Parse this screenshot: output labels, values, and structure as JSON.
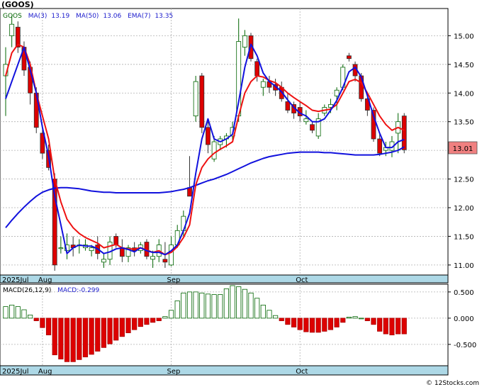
{
  "chart_data": [
    {
      "type": "candlestick",
      "title": "(GOOS)",
      "legend": [
        {
          "text": "GOOS",
          "color": "#006400"
        },
        {
          "text": "MA(3)",
          "color": "#1a1acc"
        },
        {
          "text": "13.19",
          "color": "#1a1acc"
        },
        {
          "text": "MA(50)",
          "color": "#1a1acc"
        },
        {
          "text": "13.06",
          "color": "#1a1acc"
        },
        {
          "text": "EMA(7)",
          "color": "#1a1acc"
        },
        {
          "text": "13.35",
          "color": "#1a1acc"
        }
      ],
      "yaxis": {
        "side": "right",
        "range": [
          10.85,
          15.45
        ],
        "ticks": [
          "11.00",
          "11.50",
          "12.00",
          "12.50",
          "13.00",
          "13.50",
          "14.00",
          "14.50",
          "15.00"
        ]
      },
      "last_price_label": "13.01",
      "x_labels": [
        {
          "index": 0,
          "text": "2025Jul"
        },
        {
          "index": 6,
          "text": "Aug"
        },
        {
          "index": 27,
          "text": "Sep"
        },
        {
          "index": 48,
          "text": "Oct"
        }
      ],
      "colors": {
        "up": "#006400",
        "down": "#dd0000",
        "ema": "#ee1111",
        "ma": "#1111dd",
        "axis_band": "#add8e6"
      },
      "ohlc": [
        [
          14.3,
          14.8,
          13.6,
          14.5
        ],
        [
          15.0,
          15.35,
          14.8,
          15.2
        ],
        [
          15.15,
          15.25,
          14.7,
          14.8
        ],
        [
          14.8,
          14.9,
          14.3,
          14.4
        ],
        [
          14.45,
          14.55,
          13.8,
          14.0
        ],
        [
          14.0,
          14.1,
          13.3,
          13.4
        ],
        [
          13.3,
          13.4,
          12.85,
          12.95
        ],
        [
          13.0,
          13.1,
          12.65,
          12.7
        ],
        [
          12.5,
          12.6,
          10.9,
          11.0
        ],
        [
          11.3,
          11.5,
          11.2,
          11.3
        ],
        [
          11.25,
          11.55,
          11.1,
          11.35
        ],
        [
          11.35,
          11.5,
          11.15,
          11.3
        ],
        [
          11.35,
          11.45,
          11.2,
          11.35
        ],
        [
          11.3,
          11.45,
          11.25,
          11.35
        ],
        [
          11.25,
          11.35,
          11.15,
          11.3
        ],
        [
          11.35,
          11.5,
          11.1,
          11.2
        ],
        [
          11.05,
          11.2,
          10.95,
          11.1
        ],
        [
          11.1,
          11.5,
          11.0,
          11.4
        ],
        [
          11.5,
          11.55,
          11.3,
          11.35
        ],
        [
          11.3,
          11.45,
          11.05,
          11.15
        ],
        [
          11.15,
          11.35,
          11.05,
          11.3
        ],
        [
          11.3,
          11.4,
          11.15,
          11.25
        ],
        [
          11.25,
          11.4,
          11.2,
          11.35
        ],
        [
          11.4,
          11.45,
          11.1,
          11.15
        ],
        [
          11.1,
          11.25,
          10.95,
          11.15
        ],
        [
          11.15,
          11.45,
          11.05,
          11.35
        ],
        [
          11.1,
          11.4,
          10.95,
          11.05
        ],
        [
          11.0,
          11.5,
          10.98,
          11.35
        ],
        [
          11.35,
          11.7,
          11.3,
          11.6
        ],
        [
          11.6,
          11.95,
          11.5,
          11.85
        ],
        [
          12.35,
          12.9,
          12.2,
          12.2
        ],
        [
          13.6,
          14.3,
          13.5,
          14.2
        ],
        [
          14.3,
          14.35,
          13.3,
          13.4
        ],
        [
          13.4,
          13.5,
          12.95,
          13.1
        ],
        [
          12.85,
          13.25,
          12.8,
          13.15
        ],
        [
          13.1,
          13.25,
          13.0,
          13.2
        ],
        [
          13.2,
          13.3,
          13.05,
          13.25
        ],
        [
          13.25,
          13.5,
          13.15,
          13.4
        ],
        [
          13.6,
          15.3,
          13.5,
          14.9
        ],
        [
          14.8,
          15.1,
          14.65,
          15.0
        ],
        [
          15.0,
          15.05,
          14.55,
          14.6
        ],
        [
          14.55,
          14.6,
          14.2,
          14.3
        ],
        [
          14.1,
          14.25,
          13.95,
          14.2
        ],
        [
          14.2,
          14.3,
          14.0,
          14.1
        ],
        [
          14.15,
          14.25,
          13.95,
          14.05
        ],
        [
          14.1,
          14.2,
          13.85,
          13.9
        ],
        [
          13.85,
          14.0,
          13.65,
          13.7
        ],
        [
          13.8,
          13.85,
          13.55,
          13.65
        ],
        [
          13.75,
          13.85,
          13.5,
          13.6
        ],
        [
          13.5,
          13.7,
          13.45,
          13.55
        ],
        [
          13.45,
          13.5,
          13.3,
          13.35
        ],
        [
          13.25,
          13.65,
          13.2,
          13.55
        ],
        [
          13.65,
          13.8,
          13.6,
          13.75
        ],
        [
          13.75,
          13.9,
          13.65,
          13.8
        ],
        [
          13.95,
          14.1,
          13.7,
          14.05
        ],
        [
          14.1,
          14.5,
          14.05,
          14.45
        ],
        [
          14.65,
          14.7,
          14.55,
          14.6
        ],
        [
          14.5,
          14.55,
          14.2,
          14.3
        ],
        [
          14.3,
          14.35,
          13.85,
          13.9
        ],
        [
          13.9,
          14.0,
          13.6,
          13.7
        ],
        [
          13.7,
          13.75,
          13.15,
          13.2
        ],
        [
          13.2,
          13.3,
          12.9,
          12.95
        ],
        [
          13.0,
          13.15,
          12.9,
          13.05
        ],
        [
          13.0,
          13.25,
          12.88,
          13.15
        ],
        [
          13.3,
          13.65,
          12.95,
          13.5
        ],
        [
          13.6,
          13.65,
          12.95,
          13.01
        ]
      ],
      "ema7": [
        14.3,
        14.7,
        14.85,
        14.8,
        14.5,
        14.0,
        13.6,
        13.2,
        12.5,
        12.1,
        11.8,
        11.65,
        11.55,
        11.48,
        11.43,
        11.38,
        11.3,
        11.33,
        11.36,
        11.3,
        11.28,
        11.28,
        11.3,
        11.26,
        11.22,
        11.25,
        11.18,
        11.22,
        11.32,
        11.48,
        11.7,
        12.4,
        12.7,
        12.85,
        12.95,
        13.02,
        13.08,
        13.15,
        13.6,
        14.0,
        14.2,
        14.3,
        14.28,
        14.22,
        14.18,
        14.1,
        14.0,
        13.92,
        13.85,
        13.78,
        13.7,
        13.68,
        13.7,
        13.72,
        13.8,
        14.0,
        14.2,
        14.24,
        14.18,
        14.0,
        13.8,
        13.6,
        13.45,
        13.35,
        13.4,
        13.35
      ],
      "ma3": [
        13.9,
        14.2,
        14.5,
        14.8,
        14.4,
        14.0,
        13.4,
        12.9,
        12.2,
        11.7,
        11.2,
        11.3,
        11.35,
        11.33,
        11.33,
        11.28,
        11.2,
        11.23,
        11.28,
        11.3,
        11.27,
        11.23,
        11.3,
        11.25,
        11.22,
        11.22,
        11.18,
        11.25,
        11.35,
        11.6,
        11.9,
        12.6,
        13.2,
        13.55,
        13.2,
        13.15,
        13.2,
        13.28,
        13.85,
        14.45,
        14.85,
        14.65,
        14.35,
        14.2,
        14.12,
        14.02,
        13.88,
        13.75,
        13.65,
        13.6,
        13.5,
        13.5,
        13.55,
        13.7,
        13.87,
        14.1,
        14.37,
        14.45,
        14.28,
        13.95,
        13.6,
        13.3,
        13.05,
        13.05,
        13.15,
        13.19
      ],
      "ma50": [
        11.65,
        11.78,
        11.9,
        12.01,
        12.11,
        12.2,
        12.27,
        12.31,
        12.34,
        12.35,
        12.35,
        12.34,
        12.33,
        12.31,
        12.29,
        12.28,
        12.27,
        12.27,
        12.26,
        12.26,
        12.26,
        12.26,
        12.26,
        12.26,
        12.26,
        12.26,
        12.27,
        12.28,
        12.3,
        12.32,
        12.35,
        12.39,
        12.43,
        12.47,
        12.5,
        12.54,
        12.58,
        12.63,
        12.68,
        12.73,
        12.78,
        12.82,
        12.86,
        12.89,
        12.91,
        12.93,
        12.95,
        12.96,
        12.97,
        12.97,
        12.97,
        12.97,
        12.96,
        12.96,
        12.95,
        12.94,
        12.93,
        12.92,
        12.92,
        12.92,
        12.92,
        12.93,
        12.95,
        12.97,
        13.0,
        13.06
      ]
    },
    {
      "type": "bar",
      "title": "",
      "legend": [
        {
          "text": "MACD(26,12,9)",
          "color": "#000000"
        },
        {
          "text": "MACD:",
          "color": "#1a1acc"
        },
        {
          "text": "-0.299",
          "color": "#1a1acc"
        }
      ],
      "yaxis": {
        "side": "right",
        "range": [
          -0.88,
          0.62
        ],
        "ticks": [
          "0.500",
          "0.000",
          "-0.500"
        ]
      },
      "x_labels": [
        {
          "index": 0,
          "text": "2025Jul"
        },
        {
          "index": 6,
          "text": "Aug"
        },
        {
          "index": 27,
          "text": "Sep"
        },
        {
          "index": 48,
          "text": "Oct"
        }
      ],
      "values": [
        0.22,
        0.25,
        0.22,
        0.16,
        0.06,
        -0.05,
        -0.18,
        -0.32,
        -0.7,
        -0.78,
        -0.83,
        -0.83,
        -0.79,
        -0.74,
        -0.69,
        -0.63,
        -0.56,
        -0.49,
        -0.42,
        -0.35,
        -0.28,
        -0.22,
        -0.16,
        -0.12,
        -0.08,
        -0.05,
        0.03,
        0.15,
        0.33,
        0.48,
        0.5,
        0.5,
        0.48,
        0.46,
        0.45,
        0.45,
        0.56,
        0.62,
        0.6,
        0.55,
        0.48,
        0.38,
        0.25,
        0.15,
        0.05,
        -0.05,
        -0.12,
        -0.17,
        -0.22,
        -0.26,
        -0.27,
        -0.27,
        -0.25,
        -0.22,
        -0.17,
        -0.08,
        0.02,
        0.03,
        0.0,
        -0.05,
        -0.12,
        -0.25,
        -0.3,
        -0.32,
        -0.3,
        -0.3
      ]
    }
  ],
  "footer": "© 12Stocks.com"
}
